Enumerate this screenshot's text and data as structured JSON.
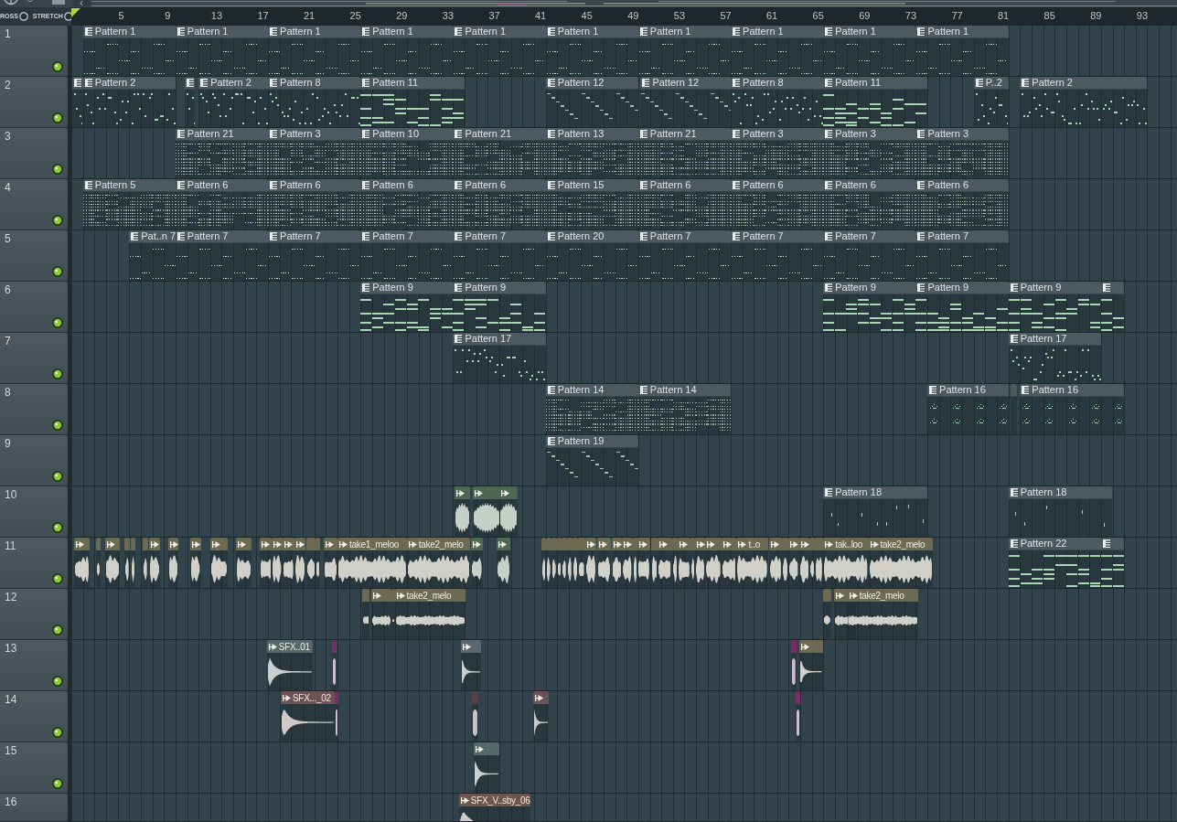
{
  "options": [
    {
      "label": "ROSS",
      "on": false
    },
    {
      "label": "STRETCH",
      "on": false
    }
  ],
  "ruler": {
    "bar_numbers": [
      "5",
      "9",
      "13",
      "17",
      "21",
      "25",
      "29",
      "33",
      "37",
      "41",
      "45",
      "49",
      "53",
      "57",
      "61",
      "65",
      "69",
      "73",
      "77",
      "81",
      "85",
      "89",
      "93"
    ]
  },
  "tracks": [
    {
      "number": "1",
      "enabled": true,
      "clips": [
        {
          "kind": "pattern",
          "label": "Pattern 1"
        },
        {
          "kind": "pattern",
          "label": "Pattern 1"
        },
        {
          "kind": "pattern",
          "label": "Pattern 1"
        },
        {
          "kind": "pattern",
          "label": "Pattern 1"
        },
        {
          "kind": "pattern",
          "label": "Pattern 1"
        },
        {
          "kind": "pattern",
          "label": "Pattern 1"
        },
        {
          "kind": "pattern",
          "label": "Pattern 1"
        },
        {
          "kind": "pattern",
          "label": "Pattern 1"
        },
        {
          "kind": "pattern",
          "label": "Pattern 1"
        },
        {
          "kind": "pattern",
          "label": "Pattern 1"
        }
      ]
    },
    {
      "number": "2",
      "enabled": true,
      "clips": [
        {
          "kind": "pattern"
        },
        {
          "kind": "pattern",
          "label": "Pattern 2"
        },
        {
          "kind": "pattern"
        },
        {
          "kind": "pattern",
          "label": "Pattern 2"
        },
        {
          "kind": "pattern",
          "label": "Pattern 8"
        },
        {
          "kind": "pattern",
          "label": "Pattern 11"
        },
        {
          "kind": "pattern",
          "label": "Pattern 12"
        },
        {
          "kind": "pattern",
          "label": "Pattern 12"
        },
        {
          "kind": "pattern",
          "label": "Pattern 8"
        },
        {
          "kind": "pattern",
          "label": "Pattern 11"
        },
        {
          "kind": "pattern",
          "label": "P..2"
        },
        {
          "kind": "pattern",
          "label": "Pattern 2"
        }
      ]
    },
    {
      "number": "3",
      "enabled": true,
      "clips": [
        {
          "kind": "pattern",
          "label": "Pattern 21"
        },
        {
          "kind": "pattern",
          "label": "Pattern 3"
        },
        {
          "kind": "pattern",
          "label": "Pattern 10"
        },
        {
          "kind": "pattern",
          "label": "Pattern 21"
        },
        {
          "kind": "pattern",
          "label": "Pattern 13"
        },
        {
          "kind": "pattern",
          "label": "Pattern 21"
        },
        {
          "kind": "pattern",
          "label": "Pattern 3"
        },
        {
          "kind": "pattern",
          "label": "Pattern 3"
        },
        {
          "kind": "pattern",
          "label": "Pattern 3"
        }
      ]
    },
    {
      "number": "4",
      "enabled": true,
      "clips": [
        {
          "kind": "pattern",
          "label": "Pattern 5"
        },
        {
          "kind": "pattern",
          "label": "Pattern 6"
        },
        {
          "kind": "pattern",
          "label": "Pattern 6"
        },
        {
          "kind": "pattern",
          "label": "Pattern 6"
        },
        {
          "kind": "pattern",
          "label": "Pattern 6"
        },
        {
          "kind": "pattern",
          "label": "Pattern 15"
        },
        {
          "kind": "pattern",
          "label": "Pattern 6"
        },
        {
          "kind": "pattern",
          "label": "Pattern 6"
        },
        {
          "kind": "pattern",
          "label": "Pattern 6"
        },
        {
          "kind": "pattern",
          "label": "Pattern 6"
        }
      ]
    },
    {
      "number": "5",
      "enabled": true,
      "clips": [
        {
          "kind": "pattern",
          "label": "Pat..n 7"
        },
        {
          "kind": "pattern",
          "label": "Pattern 7"
        },
        {
          "kind": "pattern",
          "label": "Pattern 7"
        },
        {
          "kind": "pattern",
          "label": "Pattern 7"
        },
        {
          "kind": "pattern",
          "label": "Pattern 7"
        },
        {
          "kind": "pattern",
          "label": "Pattern 20"
        },
        {
          "kind": "pattern",
          "label": "Pattern 7"
        },
        {
          "kind": "pattern",
          "label": "Pattern 7"
        },
        {
          "kind": "pattern",
          "label": "Pattern 7"
        },
        {
          "kind": "pattern",
          "label": "Pattern 7"
        }
      ]
    },
    {
      "number": "6",
      "enabled": true,
      "clips": [
        {
          "kind": "pattern",
          "label": "Pattern 9"
        },
        {
          "kind": "pattern",
          "label": "Pattern 9"
        },
        {
          "kind": "pattern",
          "label": "Pattern 9"
        },
        {
          "kind": "pattern",
          "label": "Pattern 9"
        },
        {
          "kind": "pattern",
          "label": "Pattern 9"
        },
        {
          "kind": "pattern"
        }
      ]
    },
    {
      "number": "7",
      "enabled": true,
      "clips": [
        {
          "kind": "pattern",
          "label": "Pattern 17"
        },
        {
          "kind": "pattern",
          "label": "Pattern 17"
        }
      ]
    },
    {
      "number": "8",
      "enabled": true,
      "clips": [
        {
          "kind": "pattern",
          "label": "Pattern 14"
        },
        {
          "kind": "pattern",
          "label": "Pattern 14"
        },
        {
          "kind": "pattern",
          "label": "Pattern 16"
        },
        {
          "kind": "pattern"
        },
        {
          "kind": "pattern",
          "label": "Pattern 16"
        }
      ]
    },
    {
      "number": "9",
      "enabled": true,
      "clips": [
        {
          "kind": "pattern",
          "label": "Pattern 19"
        }
      ]
    },
    {
      "number": "10",
      "enabled": true,
      "clips": [
        {
          "kind": "audio",
          "color": "#4d6853"
        },
        {
          "kind": "audio",
          "color": "#4d6853"
        },
        {
          "kind": "audio",
          "color": "#4d6853"
        },
        {
          "kind": "pattern",
          "label": "Pattern 18"
        },
        {
          "kind": "pattern",
          "label": "Pattern 18"
        }
      ]
    },
    {
      "number": "11",
      "enabled": true,
      "clips": [
        {
          "kind": "audio",
          "color": "#6c6a53"
        },
        {
          "kind": "audio",
          "color": "#6c6a53"
        },
        {
          "kind": "audio",
          "color": "#6c6a53"
        },
        {
          "kind": "audio",
          "color": "#6c6a53"
        },
        {
          "kind": "audio",
          "color": "#6c6a53"
        },
        {
          "kind": "audio",
          "color": "#6c6a53"
        },
        {
          "kind": "audio",
          "color": "#6c6a53"
        },
        {
          "kind": "audio",
          "color": "#6c6a53"
        },
        {
          "kind": "audio",
          "color": "#6c6a53"
        },
        {
          "kind": "audio",
          "color": "#6c6a53"
        },
        {
          "kind": "audio",
          "color": "#6c6a53"
        },
        {
          "kind": "audio",
          "color": "#6c6a53"
        },
        {
          "kind": "audio",
          "color": "#6c6a53"
        },
        {
          "kind": "audio",
          "color": "#6c6a53"
        },
        {
          "kind": "audio",
          "color": "#6c6a53"
        },
        {
          "kind": "audio",
          "color": "#6c6a53"
        },
        {
          "kind": "audio",
          "color": "#6c6a53"
        },
        {
          "kind": "audio",
          "color": "#6c6a53"
        },
        {
          "kind": "audio",
          "color": "#6c6a53",
          "label": "take1_meloo"
        },
        {
          "kind": "audio",
          "color": "#6c6a53",
          "label": "take2_melo"
        },
        {
          "kind": "audio",
          "color": "#4d6853"
        },
        {
          "kind": "audio",
          "color": "#4d6853"
        },
        {
          "kind": "audio",
          "color": "#6c6a53"
        },
        {
          "kind": "audio",
          "color": "#6c6a53"
        },
        {
          "kind": "audio",
          "color": "#6c6a53"
        },
        {
          "kind": "audio",
          "color": "#6c6a53"
        },
        {
          "kind": "audio",
          "color": "#6c6a53"
        },
        {
          "kind": "audio",
          "color": "#6c6a53"
        },
        {
          "kind": "audio",
          "color": "#6c6a53"
        },
        {
          "kind": "audio",
          "color": "#6c6a53"
        },
        {
          "kind": "audio",
          "color": "#6c6a53"
        },
        {
          "kind": "audio",
          "color": "#6c6a53"
        },
        {
          "kind": "audio",
          "color": "#6c6a53"
        },
        {
          "kind": "audio",
          "color": "#6c6a53"
        },
        {
          "kind": "audio",
          "color": "#6c6a53"
        },
        {
          "kind": "audio",
          "color": "#6c6a53"
        },
        {
          "kind": "audio",
          "color": "#6c6a53"
        },
        {
          "kind": "audio",
          "color": "#6c6a53"
        },
        {
          "kind": "audio",
          "color": "#6c6a53"
        },
        {
          "kind": "audio",
          "color": "#6c6a53"
        },
        {
          "kind": "audio",
          "color": "#6c6a53"
        },
        {
          "kind": "audio",
          "color": "#6c6a53"
        },
        {
          "kind": "audio",
          "color": "#6c6a53"
        },
        {
          "kind": "audio",
          "color": "#6c6a53"
        },
        {
          "kind": "audio",
          "color": "#6c6a53",
          "label": "t..o"
        },
        {
          "kind": "audio",
          "color": "#6c6a53"
        },
        {
          "kind": "audio",
          "color": "#6c6a53"
        },
        {
          "kind": "audio",
          "color": "#6c6a53"
        },
        {
          "kind": "audio",
          "color": "#6c6a53"
        },
        {
          "kind": "audio",
          "color": "#6c6a53"
        },
        {
          "kind": "audio",
          "color": "#6c6a53"
        },
        {
          "kind": "audio",
          "color": "#6c6a53",
          "label": "tak..loo"
        },
        {
          "kind": "audio",
          "color": "#6c6a53",
          "label": "take2_melo"
        },
        {
          "kind": "pattern",
          "label": "Pattern 22"
        },
        {
          "kind": "pattern"
        }
      ]
    },
    {
      "number": "12",
      "enabled": true,
      "clips": [
        {
          "kind": "audio",
          "color": "#6c6a53"
        },
        {
          "kind": "audio",
          "color": "#6c6a53"
        },
        {
          "kind": "audio",
          "color": "#6c6a53"
        },
        {
          "kind": "audio",
          "color": "#6c6a53",
          "label": "take2_melo"
        },
        {
          "kind": "audio",
          "color": "#6c6a53"
        },
        {
          "kind": "audio",
          "color": "#6c6a53"
        },
        {
          "kind": "audio",
          "color": "#6c6a53",
          "label": "take2_melo"
        }
      ]
    },
    {
      "number": "13",
      "enabled": true,
      "clips": [
        {
          "kind": "audio",
          "color": "#55686a",
          "label": "SFX..01"
        },
        {
          "kind": "audio",
          "color": "#7c2c6a"
        },
        {
          "kind": "audio",
          "color": "#5d6670"
        },
        {
          "kind": "audio",
          "color": "#7c2c6a"
        },
        {
          "kind": "audio",
          "color": "#6c6a53"
        }
      ]
    },
    {
      "number": "14",
      "enabled": true,
      "clips": [
        {
          "kind": "audio",
          "color": "#6b5355",
          "label": "SFX..._02"
        },
        {
          "kind": "audio",
          "color": "#7c2c6a"
        },
        {
          "kind": "audio",
          "color": "#573e44"
        },
        {
          "kind": "audio",
          "color": "#6a5259"
        },
        {
          "kind": "audio",
          "color": "#7c2c6a"
        }
      ]
    },
    {
      "number": "15",
      "enabled": true,
      "clips": [
        {
          "kind": "audio",
          "color": "#55686a"
        }
      ]
    },
    {
      "number": "16",
      "clips": [
        {
          "kind": "audio",
          "color": "#6d5550",
          "label": "SFX_V..sby_06"
        }
      ]
    }
  ]
}
